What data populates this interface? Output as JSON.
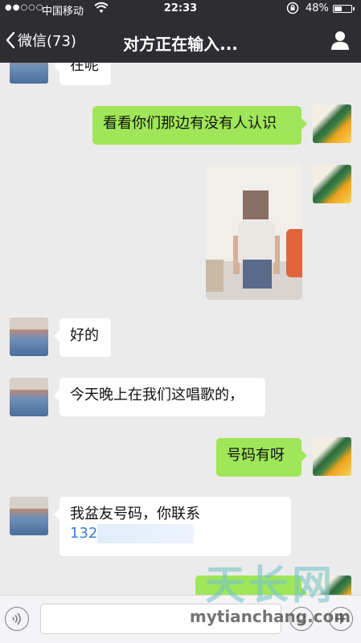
{
  "status_bar": {
    "signal": "●●○○○",
    "carrier": "中国移动",
    "time": "22:33",
    "battery_percent": "48%",
    "battery_level": 0.48
  },
  "nav": {
    "back_label": "微信(73)",
    "title": "对方正在输入..."
  },
  "messages": [
    {
      "side": "left",
      "text": "在呢"
    },
    {
      "side": "right",
      "text": "看看你们那边有没有人认识"
    },
    {
      "side": "right",
      "type": "image"
    },
    {
      "side": "left",
      "text": "好的"
    },
    {
      "side": "left",
      "text": "今天晚上在我们这唱歌的，"
    },
    {
      "side": "right",
      "text": "号码有呀"
    },
    {
      "side": "left",
      "text": "我盆友号码，你联系",
      "phone": "132"
    }
  ],
  "input": {
    "value": ""
  },
  "watermark": {
    "brand": "天长网",
    "url": "mytianchang.com"
  },
  "colors": {
    "bar": "#2e2e32",
    "background": "#ebebeb",
    "my_bubble": "#9fe658",
    "friend_bubble": "#ffffff",
    "link": "#3a7fd5"
  }
}
